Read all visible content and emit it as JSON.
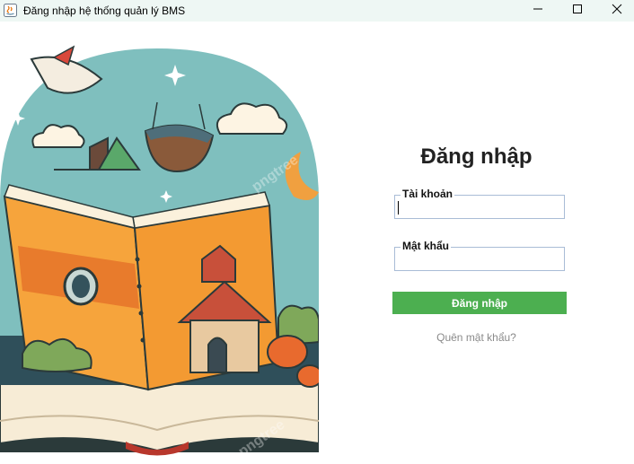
{
  "window": {
    "title": "Đăng nhập hệ thống quản lý BMS",
    "icon": "java-app-icon",
    "controls": [
      "minimize-icon",
      "maximize-icon",
      "close-icon"
    ]
  },
  "illustration": {
    "description_icon": "storybook-illustration",
    "watermark": "pngtree"
  },
  "login": {
    "title": "Đăng nhập",
    "username": {
      "label": "Tài khoản",
      "value": "",
      "placeholder": ""
    },
    "password": {
      "label": "Mật khẩu",
      "value": "",
      "placeholder": ""
    },
    "submit_label": "Đăng nhập",
    "forgot_label": "Quên mật khẩu?"
  },
  "colors": {
    "titlebar_bg": "#eef7f4",
    "button_green": "#4caf50",
    "field_border": "#a9bcd6",
    "link_gray": "#8a8a8a"
  }
}
